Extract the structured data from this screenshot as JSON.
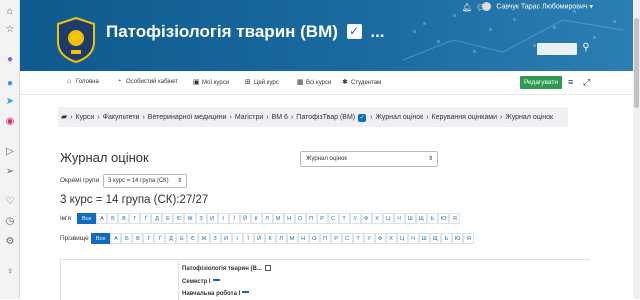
{
  "browser_strip": {
    "icons": [
      "home-icon",
      "star-icon",
      "messenger-icon",
      "messenger-alt-icon",
      "telegram-icon",
      "instagram-icon",
      "play-icon",
      "send-icon",
      "heart-icon",
      "clock-icon",
      "gear-icon",
      "bulb-icon"
    ]
  },
  "header": {
    "title": "Патофізіологія тварин (ВМ)",
    "title_suffix": "...",
    "user_name": "Савчук Тарас Любомирович"
  },
  "nav": {
    "items": [
      {
        "label": "Головна",
        "icon": "home-icon"
      },
      {
        "label": "Особистий кабінет",
        "icon": "dashboard-icon"
      },
      {
        "label": "Мої курси",
        "icon": "briefcase-icon"
      },
      {
        "label": "Цей курс",
        "icon": "sitemap-icon"
      },
      {
        "label": "Всі курси",
        "icon": "grid-icon"
      },
      {
        "label": "Студентам",
        "icon": "asterisk-icon"
      }
    ],
    "edit_label": "Редагувати"
  },
  "breadcrumb": [
    "Курси",
    "Факультети",
    "Ветеринарної медицини",
    "Магістри",
    "ВМ 6",
    "ПатофізТвар (ВМ)",
    "Журнал оцінок",
    "Керування оцінками",
    "Журнал оцінок"
  ],
  "main": {
    "page_title": "Журнал оцінок",
    "report_select": "Журнал оцінок",
    "groups_label": "Окремі групи",
    "group_selected": "3 курс = 14 група (СК)",
    "group_heading": "3 курс = 14 група (СК):27/27",
    "firstname_label": "Ім'я",
    "lastname_label": "Прізвище",
    "all_label": "Все",
    "letters": [
      "А",
      "Б",
      "В",
      "Г",
      "Ґ",
      "Д",
      "Е",
      "Є",
      "Ж",
      "З",
      "И",
      "І",
      "Ї",
      "Й",
      "К",
      "Л",
      "М",
      "Н",
      "О",
      "П",
      "Р",
      "С",
      "Т",
      "У",
      "Ф",
      "Х",
      "Ц",
      "Ч",
      "Ш",
      "Щ",
      "Ь",
      "Ю",
      "Я"
    ]
  },
  "grade_table": {
    "course_header": "Патофізіологія тварин (В...",
    "semester_label": "Семестр І",
    "work_label": "Навчальна робота І"
  },
  "colors": {
    "banner": "#1a6aa0",
    "accent": "#0f6cbf",
    "edit_button": "#2e9b50"
  }
}
